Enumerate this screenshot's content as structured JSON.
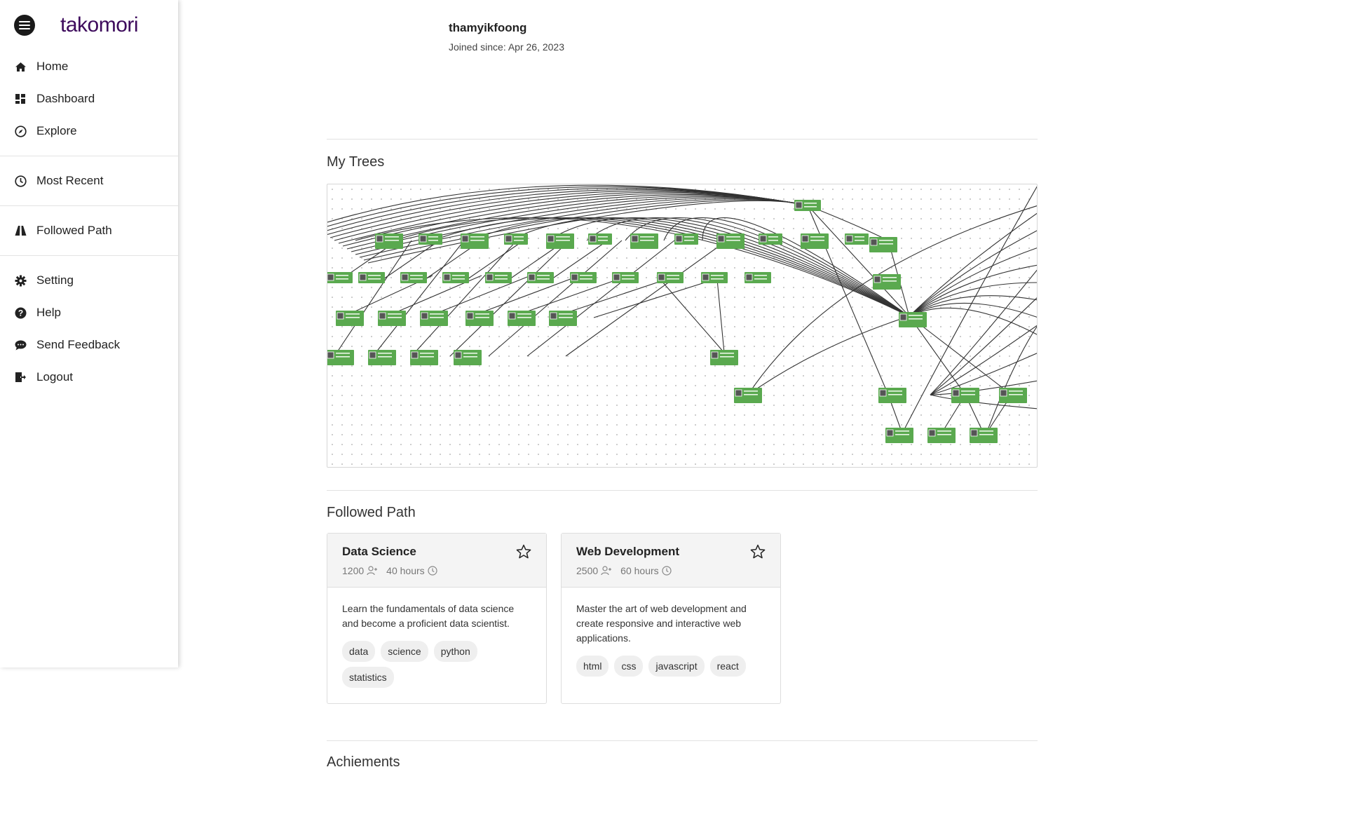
{
  "app": {
    "logo": "takomori"
  },
  "sidebar": {
    "group1": [
      {
        "label": "Home",
        "icon": "home-icon"
      },
      {
        "label": "Dashboard",
        "icon": "dashboard-icon"
      },
      {
        "label": "Explore",
        "icon": "compass-icon"
      }
    ],
    "group2": [
      {
        "label": "Most Recent",
        "icon": "clock-icon"
      }
    ],
    "group3": [
      {
        "label": "Followed Path",
        "icon": "road-icon"
      }
    ],
    "group4": [
      {
        "label": "Setting",
        "icon": "gear-icon"
      },
      {
        "label": "Help",
        "icon": "help-icon"
      },
      {
        "label": "Send Feedback",
        "icon": "chat-icon"
      },
      {
        "label": "Logout",
        "icon": "logout-icon"
      }
    ]
  },
  "profile": {
    "username": "thamyikfoong",
    "joined": "Joined since: Apr 26, 2023"
  },
  "sections": {
    "trees": "My Trees",
    "followed": "Followed Path",
    "achievements": "Achiements"
  },
  "colors": {
    "node": "#5aa94f",
    "brand": "#3d0a5c"
  },
  "followed_paths": [
    {
      "title": "Data Science",
      "followers": "1200",
      "duration": "40 hours",
      "description": "Learn the fundamentals of data science and become a proficient data scientist.",
      "tags": [
        "data",
        "science",
        "python",
        "statistics"
      ]
    },
    {
      "title": "Web Development",
      "followers": "2500",
      "duration": "60 hours",
      "description": "Master the art of web development and create responsive and interactive web applications.",
      "tags": [
        "html",
        "css",
        "javascript",
        "react"
      ]
    }
  ]
}
